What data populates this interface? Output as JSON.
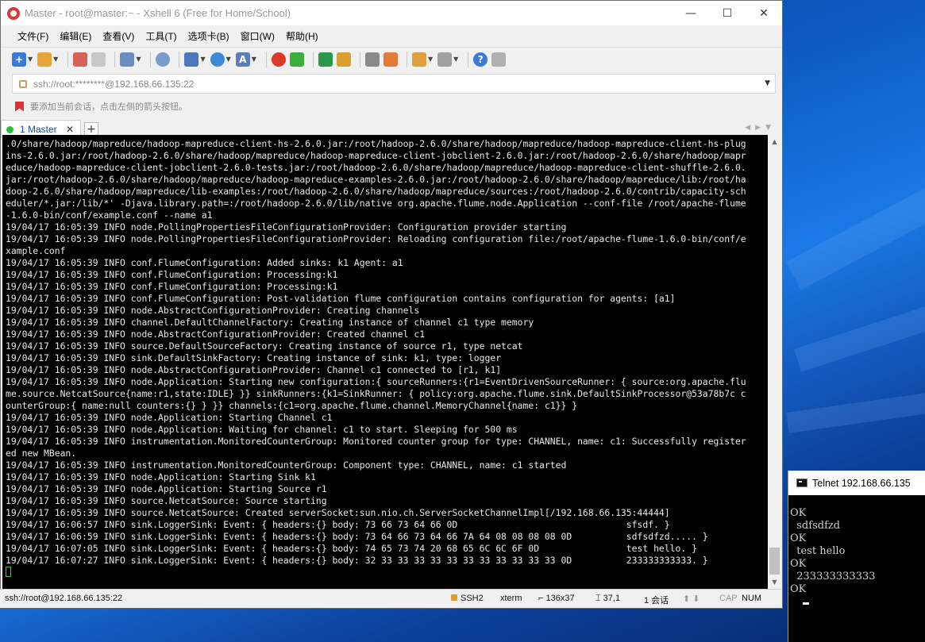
{
  "window": {
    "title": "Master - root@master:~ - Xshell 6 (Free for Home/School)",
    "controls": {
      "minimize": "—",
      "maximize": "☐",
      "close": "✕"
    }
  },
  "menu": [
    "文件(F)",
    "编辑(E)",
    "查看(V)",
    "工具(T)",
    "选项卡(B)",
    "窗口(W)",
    "帮助(H)"
  ],
  "address": {
    "value": "ssh://root:********@192.168.66.135:22"
  },
  "hint": {
    "text": "要添加当前会话，点击左侧的箭头按钮。"
  },
  "tab": {
    "label": "1 Master",
    "close": "✕",
    "add": "+"
  },
  "terminal": {
    "lines": [
      ".0/share/hadoop/mapreduce/hadoop-mapreduce-client-hs-2.6.0.jar:/root/hadoop-2.6.0/share/hadoop/mapreduce/hadoop-mapreduce-client-hs-plug",
      "ins-2.6.0.jar:/root/hadoop-2.6.0/share/hadoop/mapreduce/hadoop-mapreduce-client-jobclient-2.6.0.jar:/root/hadoop-2.6.0/share/hadoop/mapr",
      "educe/hadoop-mapreduce-client-jobclient-2.6.0-tests.jar:/root/hadoop-2.6.0/share/hadoop/mapreduce/hadoop-mapreduce-client-shuffle-2.6.0.",
      "jar:/root/hadoop-2.6.0/share/hadoop/mapreduce/hadoop-mapreduce-examples-2.6.0.jar:/root/hadoop-2.6.0/share/hadoop/mapreduce/lib:/root/ha",
      "doop-2.6.0/share/hadoop/mapreduce/lib-examples:/root/hadoop-2.6.0/share/hadoop/mapreduce/sources:/root/hadoop-2.6.0/contrib/capacity-sch",
      "eduler/*.jar:/lib/*' -Djava.library.path=:/root/hadoop-2.6.0/lib/native org.apache.flume.node.Application --conf-file /root/apache-flume",
      "-1.6.0-bin/conf/example.conf --name a1",
      "19/04/17 16:05:39 INFO node.PollingPropertiesFileConfigurationProvider: Configuration provider starting",
      "19/04/17 16:05:39 INFO node.PollingPropertiesFileConfigurationProvider: Reloading configuration file:/root/apache-flume-1.6.0-bin/conf/e",
      "xample.conf",
      "19/04/17 16:05:39 INFO conf.FlumeConfiguration: Added sinks: k1 Agent: a1",
      "19/04/17 16:05:39 INFO conf.FlumeConfiguration: Processing:k1",
      "19/04/17 16:05:39 INFO conf.FlumeConfiguration: Processing:k1",
      "19/04/17 16:05:39 INFO conf.FlumeConfiguration: Post-validation flume configuration contains configuration for agents: [a1]",
      "19/04/17 16:05:39 INFO node.AbstractConfigurationProvider: Creating channels",
      "19/04/17 16:05:39 INFO channel.DefaultChannelFactory: Creating instance of channel c1 type memory",
      "19/04/17 16:05:39 INFO node.AbstractConfigurationProvider: Created channel c1",
      "19/04/17 16:05:39 INFO source.DefaultSourceFactory: Creating instance of source r1, type netcat",
      "19/04/17 16:05:39 INFO sink.DefaultSinkFactory: Creating instance of sink: k1, type: logger",
      "19/04/17 16:05:39 INFO node.AbstractConfigurationProvider: Channel c1 connected to [r1, k1]",
      "19/04/17 16:05:39 INFO node.Application: Starting new configuration:{ sourceRunners:{r1=EventDrivenSourceRunner: { source:org.apache.flu",
      "me.source.NetcatSource{name:r1,state:IDLE} }} sinkRunners:{k1=SinkRunner: { policy:org.apache.flume.sink.DefaultSinkProcessor@53a78b7c c",
      "ounterGroup:{ name:null counters:{} } }} channels:{c1=org.apache.flume.channel.MemoryChannel{name: c1}} }",
      "19/04/17 16:05:39 INFO node.Application: Starting Channel c1",
      "19/04/17 16:05:39 INFO node.Application: Waiting for channel: c1 to start. Sleeping for 500 ms",
      "19/04/17 16:05:39 INFO instrumentation.MonitoredCounterGroup: Monitored counter group for type: CHANNEL, name: c1: Successfully register",
      "ed new MBean.",
      "19/04/17 16:05:39 INFO instrumentation.MonitoredCounterGroup: Component type: CHANNEL, name: c1 started",
      "19/04/17 16:05:39 INFO node.Application: Starting Sink k1",
      "19/04/17 16:05:39 INFO node.Application: Starting Source r1",
      "19/04/17 16:05:39 INFO source.NetcatSource: Source starting",
      "19/04/17 16:05:39 INFO source.NetcatSource: Created serverSocket:sun.nio.ch.ServerSocketChannelImpl[/192.168.66.135:44444]",
      "19/04/17 16:06:57 INFO sink.LoggerSink: Event: { headers:{} body: 73 66 73 64 66 0D                               sfsdf. }",
      "19/04/17 16:06:59 INFO sink.LoggerSink: Event: { headers:{} body: 73 64 66 73 64 66 7A 64 08 08 08 08 0D          sdfsdfzd..... }",
      "19/04/17 16:07:05 INFO sink.LoggerSink: Event: { headers:{} body: 74 65 73 74 20 68 65 6C 6C 6F 0D                test hello. }",
      "19/04/17 16:07:27 INFO sink.LoggerSink: Event: { headers:{} body: 32 33 33 33 33 33 33 33 33 33 33 33 0D          233333333333. }"
    ]
  },
  "status": {
    "connection": "ssh://root@192.168.66.135:22",
    "protocol": "SSH2",
    "terminal_type": "xterm",
    "size": "136x37",
    "cursor_pos": "37,1",
    "sessions": "1 会话",
    "cap": "CAP",
    "num": "NUM"
  },
  "telnet": {
    "title": "Telnet 192.168.66.135",
    "lines": [
      "OK",
      "  sdfsdfzd",
      "OK",
      "  test hello",
      "OK",
      "  233333333333",
      "OK"
    ]
  },
  "colors": {
    "terminal_bg": "#000000",
    "terminal_fg": "#e8e8e8",
    "cursor": "#2fd24a",
    "tab_accent": "#1a4ea8"
  }
}
